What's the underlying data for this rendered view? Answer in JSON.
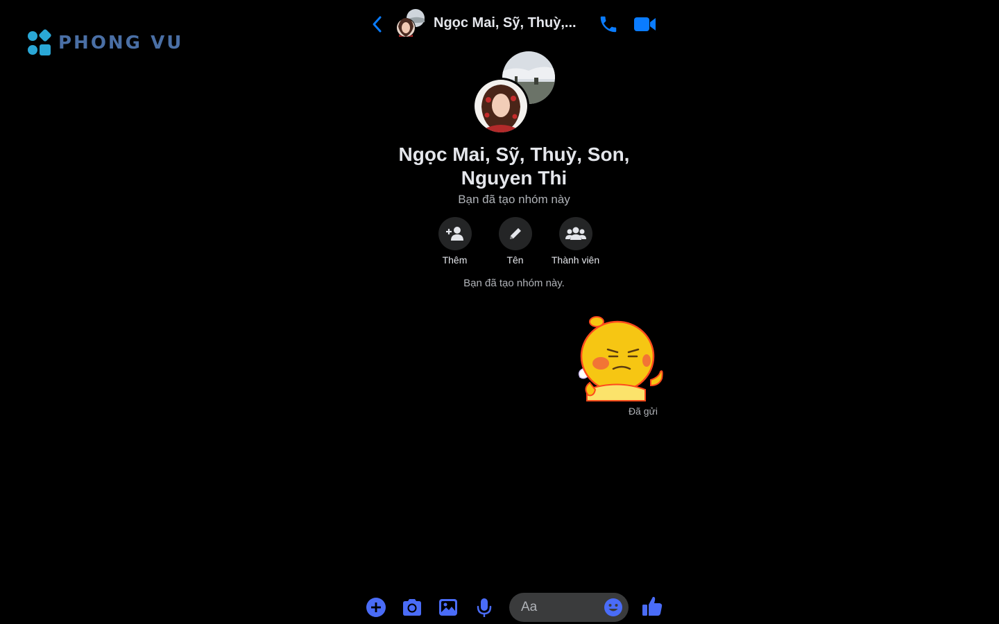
{
  "watermark": {
    "text": "PHONG VU"
  },
  "header": {
    "title": "Ngọc Mai, Sỹ, Thuỳ,...",
    "back_icon": "chevron-left-icon",
    "call_icon": "phone-icon",
    "video_icon": "video-camera-icon"
  },
  "group": {
    "name": "Ngọc Mai, Sỹ, Thuỳ, Son, Nguyen Thi",
    "subtitle": "Bạn đã tạo nhóm này",
    "actions": [
      {
        "label": "Thêm",
        "icon": "add-person-icon"
      },
      {
        "label": "Tên",
        "icon": "pencil-icon"
      },
      {
        "label": "Thành viên",
        "icon": "group-icon"
      }
    ]
  },
  "messages": {
    "system_note": "Bạn đã tạo nhóm này.",
    "sticker": "sticker-icon",
    "status": "Đã gửi"
  },
  "composer": {
    "placeholder": "Aa",
    "buttons": [
      "plus-icon",
      "camera-icon",
      "image-icon",
      "microphone-icon"
    ],
    "emoji_icon": "smiley-icon",
    "like_icon": "thumbs-up-icon"
  },
  "colors": {
    "accent": "#0a7cff",
    "background": "#000000",
    "action_bg": "#242526",
    "input_bg": "#3a3b3c",
    "composer_icon": "#4a6cf7"
  }
}
